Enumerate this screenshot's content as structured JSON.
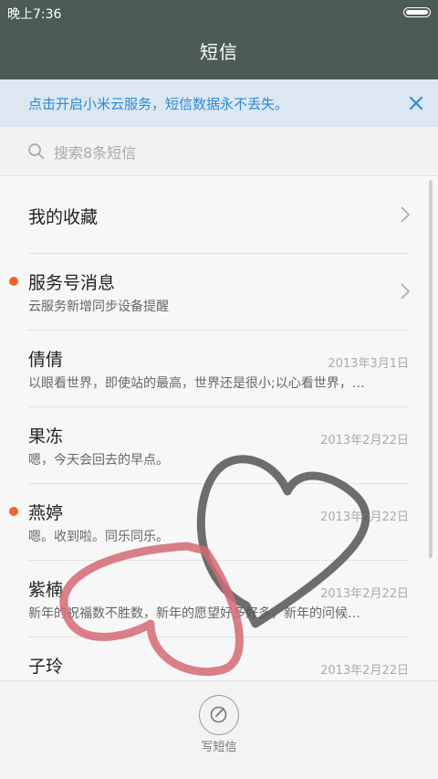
{
  "status_bar": {
    "time": "晚上7:36",
    "battery_icon": "battery-icon"
  },
  "header": {
    "title": "短信"
  },
  "banner": {
    "text": "点击开启小米云服务，短信数据永不丢失。",
    "close_icon": "close-icon"
  },
  "search": {
    "placeholder": "搜索8条短信",
    "icon": "search-icon"
  },
  "list": {
    "favorites": {
      "label": "我的收藏"
    },
    "items": [
      {
        "name": "服务号消息",
        "preview": "云服务新增同步设备提醒",
        "date": "",
        "unread": true
      },
      {
        "name": "倩倩",
        "preview": "以眼看世界，即使站的最高，世界还是很小;以心看世界，…",
        "date": "2013年3月1日",
        "unread": false
      },
      {
        "name": "果冻",
        "preview": "嗯，今天会回去的早点。",
        "date": "2013年2月22日",
        "unread": false
      },
      {
        "name": "燕婷",
        "preview": "嗯。收到啦。同乐同乐。",
        "date": "2013年2月22日",
        "unread": true
      },
      {
        "name": "紫楠",
        "preview": "新年的祝福数不胜数，新年的愿望好多好多，新年的问候…",
        "date": "2013年2月22日",
        "unread": false
      },
      {
        "name": "子玲",
        "preview": "",
        "date": "2013年2月22日",
        "unread": false
      }
    ]
  },
  "bottom": {
    "compose_label": "写短信",
    "compose_icon": "compose-icon"
  },
  "colors": {
    "header_bg": "#4c5b58",
    "accent": "#2d8ad8",
    "unread_dot": "#f0662a"
  }
}
